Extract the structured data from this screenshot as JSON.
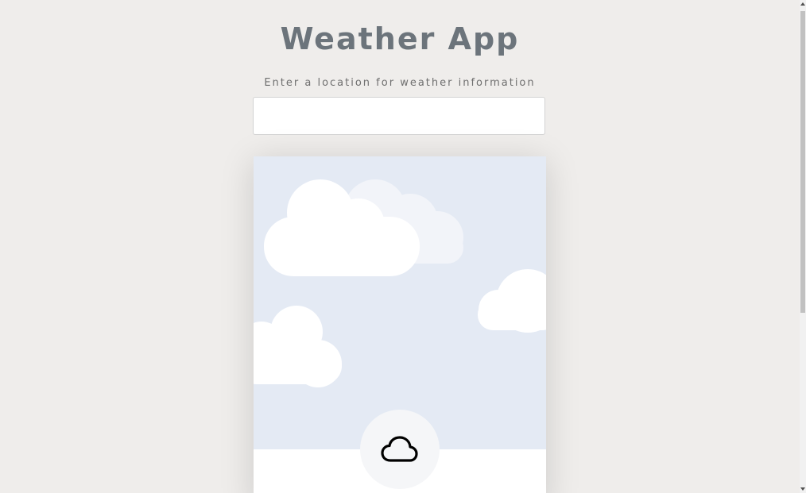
{
  "app": {
    "title": "Weather App",
    "subtitle": "Enter a location for weather information"
  },
  "search": {
    "value": "",
    "placeholder": ""
  },
  "weather_card": {
    "condition_icon": "cloud-icon",
    "sky_color": "#e4eaf4"
  },
  "colors": {
    "background": "#efedeb",
    "title": "#6c747b",
    "sky": "#e4eaf4",
    "cloud": "#ffffff"
  }
}
